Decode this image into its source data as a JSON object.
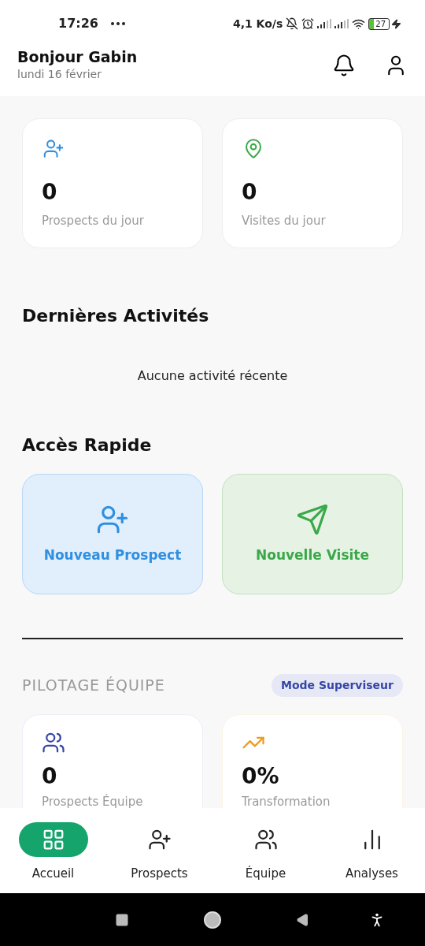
{
  "status_bar": {
    "time": "17:26",
    "speed": "4,1 Ko/s",
    "battery": "27"
  },
  "header": {
    "greeting": "Bonjour Gabin",
    "date": "lundi 16 février"
  },
  "stats": [
    {
      "color": "#2f8fe0",
      "value": "0",
      "label": "Prospects du jour"
    },
    {
      "color": "#3aa84a",
      "value": "0",
      "label": "Visites du jour"
    }
  ],
  "activities": {
    "title": "Dernières Activités",
    "empty": "Aucune activité récente"
  },
  "quick_access": {
    "title": "Accès Rapide",
    "actions": [
      {
        "color": "#2f8fe0",
        "label": "Nouveau Prospect"
      },
      {
        "color": "#3aa84a",
        "label": "Nouvelle Visite"
      }
    ]
  },
  "team": {
    "title": "PILOTAGE ÉQUIPE",
    "badge": "Mode Superviseur",
    "stats": [
      {
        "color": "#3545a8",
        "value": "0",
        "label": "Prospects Équipe"
      },
      {
        "color": "#f09a18",
        "value": "0%",
        "label": "Transformation"
      }
    ]
  },
  "nav": [
    {
      "label": "Accueil",
      "selected": true
    },
    {
      "label": "Prospects",
      "selected": false
    },
    {
      "label": "Équipe",
      "selected": false
    },
    {
      "label": "Analyses",
      "selected": false
    }
  ]
}
